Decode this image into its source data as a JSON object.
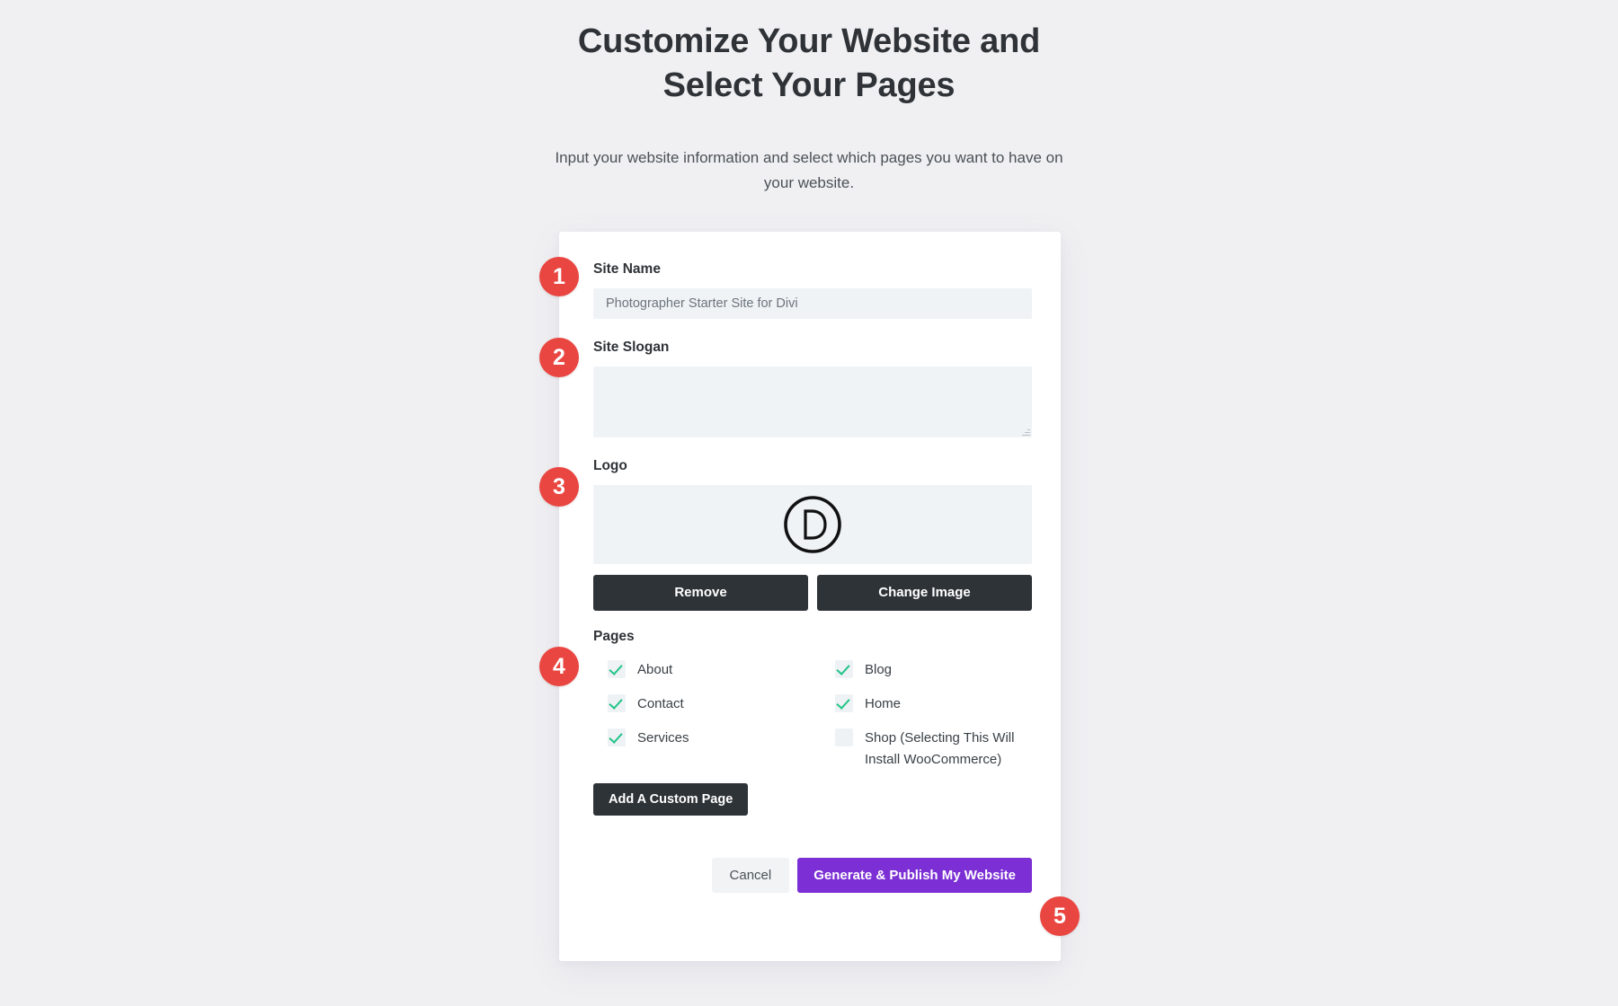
{
  "header": {
    "title": "Customize Your Website and Select Your Pages",
    "subtitle": "Input your website information and select which pages you want to have on your website."
  },
  "form": {
    "site_name": {
      "label": "Site Name",
      "value": "Photographer Starter Site for Divi",
      "placeholder": ""
    },
    "site_slogan": {
      "label": "Site Slogan",
      "value": "",
      "placeholder": ""
    },
    "logo": {
      "label": "Logo",
      "mark_letter": "D",
      "remove_label": "Remove",
      "change_label": "Change Image"
    },
    "pages": {
      "label": "Pages",
      "items": [
        {
          "label": "About",
          "checked": true
        },
        {
          "label": "Blog",
          "checked": true
        },
        {
          "label": "Contact",
          "checked": true
        },
        {
          "label": "Home",
          "checked": true
        },
        {
          "label": "Services",
          "checked": true
        },
        {
          "label": "Shop (Selecting This Will Install WooCommerce)",
          "checked": false
        }
      ],
      "add_page_label": "Add A Custom Page"
    }
  },
  "actions": {
    "cancel_label": "Cancel",
    "primary_label": "Generate & Publish My Website"
  },
  "steps": [
    {
      "number": "1"
    },
    {
      "number": "2"
    },
    {
      "number": "3"
    },
    {
      "number": "4"
    },
    {
      "number": "5"
    }
  ],
  "colors": {
    "page_background": "#f0f0f2",
    "card_background": "#ffffff",
    "badge": "#ea4641",
    "primary_button": "#7b2fd4",
    "dark_button": "#2e3338",
    "field_background": "#eff3f6",
    "check_mark": "#23c489",
    "heading_text": "#2f3337"
  }
}
